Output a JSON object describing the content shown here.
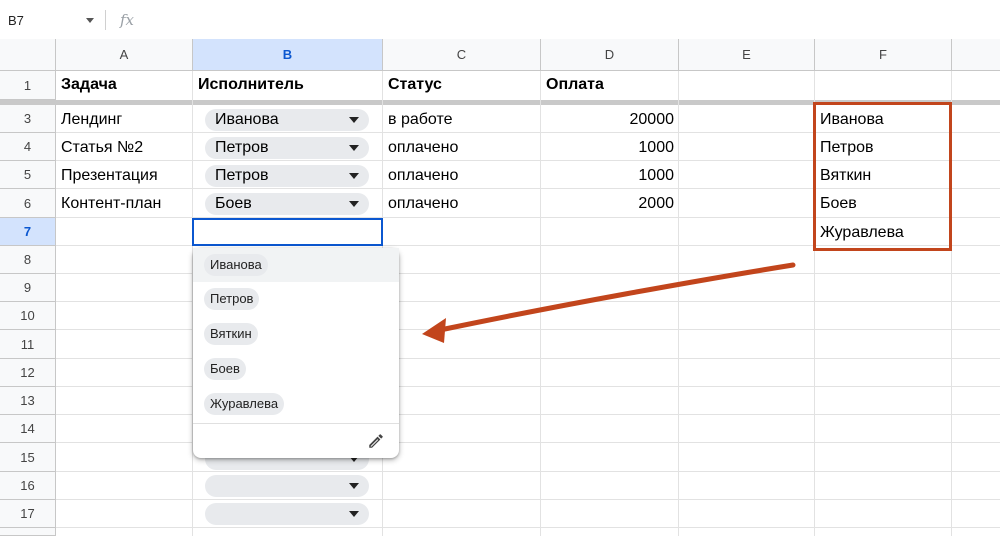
{
  "formula_bar": {
    "name_box": "B7",
    "fx_label": "fx"
  },
  "columns": [
    "A",
    "B",
    "C",
    "D",
    "E",
    "F"
  ],
  "rows": [
    "1",
    "3",
    "4",
    "5",
    "6",
    "7",
    "8",
    "9",
    "10",
    "11",
    "12",
    "13",
    "14",
    "15",
    "16",
    "17"
  ],
  "header": {
    "a": "Задача",
    "b": "Исполнитель",
    "c": "Статус",
    "d": "Оплата"
  },
  "data_rows": [
    {
      "task": "Лендинг",
      "assignee": "Иванова",
      "status": "в работе",
      "payment": "20000"
    },
    {
      "task": "Статья №2",
      "assignee": "Петров",
      "status": "оплачено",
      "payment": "1000"
    },
    {
      "task": "Презентация",
      "assignee": "Петров",
      "status": "оплачено",
      "payment": "1000"
    },
    {
      "task": "Контент-план",
      "assignee": "Боев",
      "status": "оплачено",
      "payment": "2000"
    }
  ],
  "names_list": [
    "Иванова",
    "Петров",
    "Вяткин",
    "Боев",
    "Журавлева"
  ],
  "dropdown_options": [
    "Иванова",
    "Петров",
    "Вяткин",
    "Боев",
    "Журавлева"
  ],
  "colors": {
    "accent": "#0b57d0",
    "annotation": "#c2451c",
    "chip": "#e8eaed"
  }
}
